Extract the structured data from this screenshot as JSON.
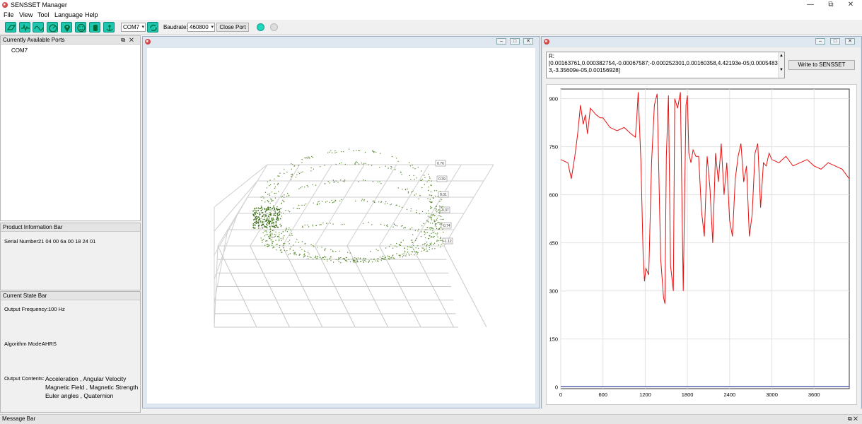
{
  "app": {
    "title": "SENSSET Manager"
  },
  "window_controls": {
    "minimize": "—",
    "restore": "⧉",
    "close": "✕"
  },
  "menu": [
    "File",
    "View",
    "Tool",
    "Language",
    "Help"
  ],
  "toolbar": {
    "icons": [
      "calibrate-icon",
      "waveform-icon",
      "wave-icon",
      "gauge-icon",
      "location-icon",
      "smile-icon",
      "hand-icon",
      "anchor-icon"
    ],
    "port_value": "COM7",
    "baudrate_label": "Baudrate:",
    "baudrate_value": "460800",
    "close_port_label": "Close Port",
    "status_color": "#1fd7bb"
  },
  "ports_panel": {
    "title": "Currently Available Ports",
    "ports": [
      "COM7"
    ]
  },
  "product_panel": {
    "title": "Product Information Bar",
    "serial_label": "Serial Number:",
    "serial_value": "21 04 00 6a 00 18 24 01"
  },
  "state_panel": {
    "title": "Current State Bar",
    "freq_label": "Output Frequency:",
    "freq_value": "100 Hz",
    "algo_label": "Algorithm Mode:",
    "algo_value": "AHRS",
    "contents_label": "Output Contents:",
    "contents_lines": [
      "Acceleration , Angular Velocity",
      "Magnetic Field , Magnetic Strength",
      "Euler angles , Quaternion"
    ]
  },
  "plot3d": {
    "z_ticks": [
      "0.76",
      "0.39",
      "0.01",
      "-0.37",
      "-0.74",
      "-1.12"
    ],
    "color": "#5a8a30"
  },
  "calib": {
    "text": "R:\n[0.00163761,0.000382754,-0.00067587;-0.000252301,0.00160358,4.42193e-05;0.000548343,-3.35609e-05,0.00156928]",
    "write_button": "Write to SENSSET"
  },
  "chart_data": {
    "type": "line",
    "x_ticks": [
      "0",
      "600",
      "1200",
      "1800",
      "2400",
      "3000",
      "3600"
    ],
    "y_ticks": [
      "0",
      "150",
      "300",
      "450",
      "600",
      "750",
      "900"
    ],
    "xlim": [
      0,
      4100
    ],
    "ylim": [
      -5,
      930
    ],
    "grid": true,
    "series": [
      {
        "color": "#e81010",
        "x": [
          0,
          100,
          150,
          200,
          240,
          280,
          320,
          350,
          380,
          420,
          460,
          500,
          560,
          600,
          700,
          800,
          900,
          1000,
          1060,
          1080,
          1100,
          1140,
          1170,
          1190,
          1210,
          1250,
          1290,
          1330,
          1370,
          1420,
          1460,
          1480,
          1500,
          1530,
          1560,
          1600,
          1620,
          1660,
          1700,
          1740,
          1780,
          1800,
          1820,
          1850,
          1880,
          1920,
          1960,
          2000,
          2040,
          2080,
          2120,
          2160,
          2200,
          2240,
          2280,
          2320,
          2360,
          2400,
          2440,
          2480,
          2520,
          2560,
          2600,
          2640,
          2680,
          2720,
          2760,
          2800,
          2840,
          2880,
          2920,
          2960,
          3000,
          3100,
          3200,
          3300,
          3400,
          3500,
          3600,
          3700,
          3800,
          3900,
          4000,
          4100
        ],
        "y": [
          710,
          700,
          650,
          720,
          790,
          880,
          820,
          850,
          790,
          870,
          860,
          850,
          840,
          840,
          810,
          800,
          810,
          790,
          780,
          840,
          920,
          700,
          420,
          330,
          370,
          350,
          700,
          880,
          915,
          400,
          280,
          260,
          720,
          910,
          380,
          300,
          900,
          870,
          920,
          300,
          880,
          910,
          730,
          700,
          740,
          720,
          720,
          550,
          470,
          720,
          620,
          450,
          730,
          640,
          760,
          600,
          700,
          520,
          470,
          650,
          720,
          760,
          640,
          690,
          470,
          540,
          730,
          760,
          560,
          700,
          690,
          730,
          710,
          700,
          720,
          690,
          700,
          710,
          690,
          680,
          700,
          690,
          680,
          650
        ]
      },
      {
        "color": "#2030a0",
        "x": [
          0,
          4100
        ],
        "y": [
          2,
          2
        ]
      }
    ]
  }
}
